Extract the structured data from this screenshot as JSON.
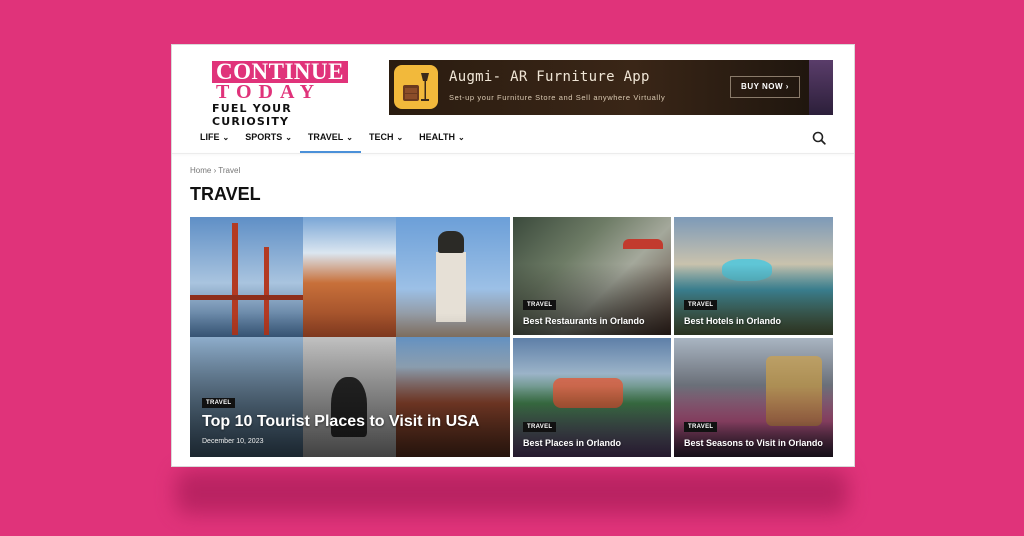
{
  "logo": {
    "line1": "CONTINUE",
    "line2": "TODAY",
    "tagline": "FUEL YOUR CURIOSITY"
  },
  "ad": {
    "title": "Augmi- AR Furniture App",
    "subtitle": "Set-up your Furniture Store and Sell anywhere Virtually",
    "cta": "BUY NOW ›"
  },
  "nav": {
    "items": [
      {
        "label": "LIFE"
      },
      {
        "label": "SPORTS"
      },
      {
        "label": "TRAVEL"
      },
      {
        "label": "TECH"
      },
      {
        "label": "HEALTH"
      }
    ],
    "active": "TRAVEL",
    "chevron": "⌄"
  },
  "breadcrumb": "Home › Travel",
  "page_title": "TRAVEL",
  "featured": {
    "tag": "TRAVEL",
    "title": "Top 10 Tourist Places to Visit in USA",
    "date": "December 10, 2023"
  },
  "posts": [
    {
      "tag": "TRAVEL",
      "title": "Best Restaurants in Orlando"
    },
    {
      "tag": "TRAVEL",
      "title": "Best Hotels in Orlando"
    },
    {
      "tag": "TRAVEL",
      "title": "Best Places in Orlando"
    },
    {
      "tag": "TRAVEL",
      "title": "Best Seasons to Visit in Orlando"
    }
  ],
  "colors": {
    "background": "#e0337a",
    "brand": "#e0337a",
    "active_underline": "#4a90d9"
  }
}
